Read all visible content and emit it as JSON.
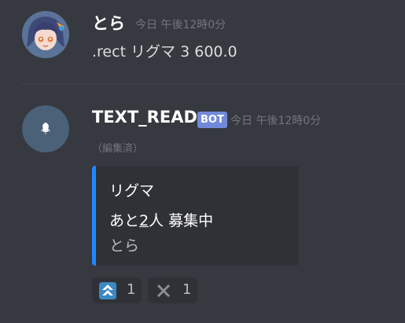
{
  "messages": [
    {
      "author": "とら",
      "timestamp": "今日 午後12時0分",
      "content": ".rect リグマ 3 600.0",
      "avatar_icon": "anime-girl-avatar"
    },
    {
      "author": "TEXT_READ",
      "bot_tag": "BOT",
      "timestamp": "今日 午後12時0分",
      "edited": "（編集済）",
      "avatar_icon": "bot-avatar",
      "embed": {
        "accent_color": "#1e88ff",
        "title": "リグマ",
        "desc_prefix": "あと",
        "desc_count": "2",
        "desc_suffix": "人 募集中",
        "footer": "とら"
      },
      "reactions": [
        {
          "emoji": "double-up-arrow-icon",
          "count": "1"
        },
        {
          "emoji": "heavy-x-icon",
          "count": "1"
        }
      ]
    }
  ],
  "colors": {
    "background": "#36393f",
    "embed_background": "#2f3136",
    "bot_tag": "#7289da",
    "timestamp": "#72767d"
  }
}
